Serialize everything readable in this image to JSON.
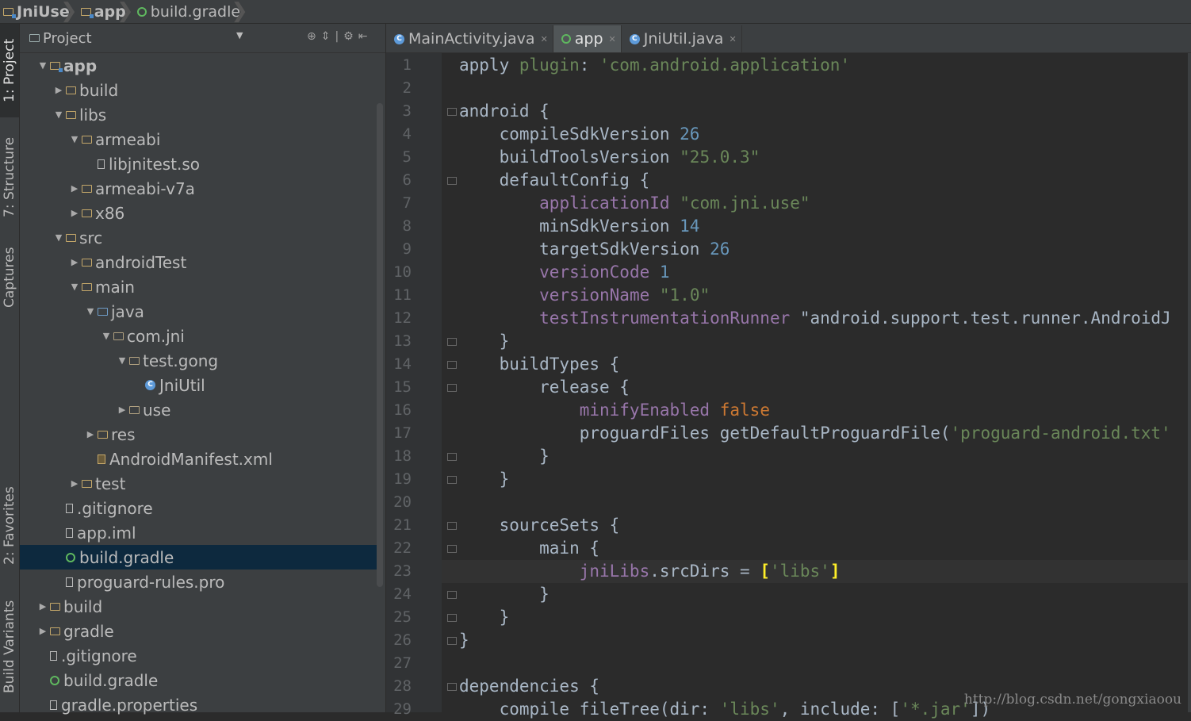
{
  "breadcrumb": [
    "JniUse",
    "app",
    "build.gradle"
  ],
  "toolwindows": [
    "1: Project",
    "7: Structure",
    "Captures",
    "2: Favorites",
    "Build Variants"
  ],
  "project_panel": {
    "title": "Project",
    "tree": [
      {
        "label": "app",
        "icon": "module-folder-icon",
        "expanded": true,
        "bold": true
      },
      {
        "label": "build",
        "icon": "folder-icon",
        "expanded": false
      },
      {
        "label": "libs",
        "icon": "folder-icon",
        "expanded": true
      },
      {
        "label": "armeabi",
        "icon": "folder-icon",
        "expanded": true
      },
      {
        "label": "libjnitest.so",
        "icon": "file-icon"
      },
      {
        "label": "armeabi-v7a",
        "icon": "folder-icon",
        "expanded": false
      },
      {
        "label": "x86",
        "icon": "folder-icon",
        "expanded": false
      },
      {
        "label": "src",
        "icon": "folder-icon",
        "expanded": true
      },
      {
        "label": "androidTest",
        "icon": "folder-icon",
        "expanded": false
      },
      {
        "label": "main",
        "icon": "folder-icon",
        "expanded": true
      },
      {
        "label": "java",
        "icon": "source-folder-icon",
        "expanded": true
      },
      {
        "label": "com.jni",
        "icon": "package-icon",
        "expanded": true
      },
      {
        "label": "test.gong",
        "icon": "package-icon",
        "expanded": true
      },
      {
        "label": "JniUtil",
        "icon": "class-icon"
      },
      {
        "label": "use",
        "icon": "package-icon",
        "expanded": false
      },
      {
        "label": "res",
        "icon": "resource-folder-icon",
        "expanded": false
      },
      {
        "label": "AndroidManifest.xml",
        "icon": "xml-file-icon"
      },
      {
        "label": "test",
        "icon": "folder-icon",
        "expanded": false
      },
      {
        "label": ".gitignore",
        "icon": "file-icon"
      },
      {
        "label": "app.iml",
        "icon": "file-icon"
      },
      {
        "label": "build.gradle",
        "icon": "gradle-icon",
        "selected": true
      },
      {
        "label": "proguard-rules.pro",
        "icon": "file-icon"
      },
      {
        "label": "build",
        "icon": "folder-icon",
        "expanded": false
      },
      {
        "label": "gradle",
        "icon": "folder-icon",
        "expanded": false
      },
      {
        "label": ".gitignore",
        "icon": "file-icon"
      },
      {
        "label": "build.gradle",
        "icon": "gradle-icon"
      },
      {
        "label": "gradle.properties",
        "icon": "file-icon"
      }
    ]
  },
  "editor_tabs": [
    {
      "label": "MainActivity.java",
      "icon": "class-icon",
      "active": false
    },
    {
      "label": "app",
      "icon": "gradle-icon",
      "active": true
    },
    {
      "label": "JniUtil.java",
      "icon": "class-icon",
      "active": false
    }
  ],
  "code_lines": [
    "apply plugin: 'com.android.application'",
    "",
    "android {",
    "    compileSdkVersion 26",
    "    buildToolsVersion \"25.0.3\"",
    "    defaultConfig {",
    "        applicationId \"com.jni.use\"",
    "        minSdkVersion 14",
    "        targetSdkVersion 26",
    "        versionCode 1",
    "        versionName \"1.0\"",
    "        testInstrumentationRunner \"android.support.test.runner.AndroidJ",
    "    }",
    "    buildTypes {",
    "        release {",
    "            minifyEnabled false",
    "            proguardFiles getDefaultProguardFile('proguard-android.txt'",
    "        }",
    "    }",
    "",
    "    sourceSets {",
    "        main {",
    "            jniLibs.srcDirs = ['libs']",
    "        }",
    "    }",
    "}",
    "",
    "dependencies {",
    "    compile fileTree(dir: 'libs', include: ['*.jar'])"
  ],
  "current_line": 23,
  "watermark": "http://blog.csdn.net/gongxiaoou",
  "colors": {
    "keyword": "#cc7832",
    "string": "#6a8759",
    "number": "#6897bb",
    "property": "#9876aa",
    "text": "#a9b7c6"
  }
}
